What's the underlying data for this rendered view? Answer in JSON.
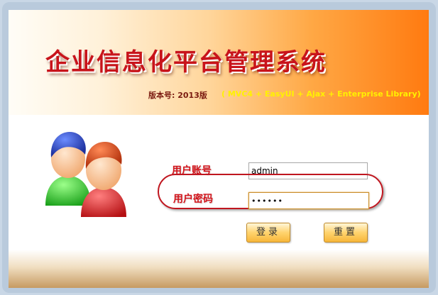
{
  "header": {
    "title": "企业信息化平台管理系统",
    "version": "版本号: 2013版",
    "tech_stack": "( MVC4 + EasyUI + Ajax + Enterprise Library)"
  },
  "form": {
    "username_label": "用户账号",
    "username_value": "admin",
    "password_label": "用户密码",
    "password_value": "••••••"
  },
  "buttons": {
    "login_label": "登录",
    "reset_label": "重置"
  },
  "colors": {
    "title": "#c8141b",
    "label": "#d3131a",
    "tech_text": "#fff200",
    "highlight": "#c0161f"
  },
  "icons": [
    "users-icon"
  ]
}
